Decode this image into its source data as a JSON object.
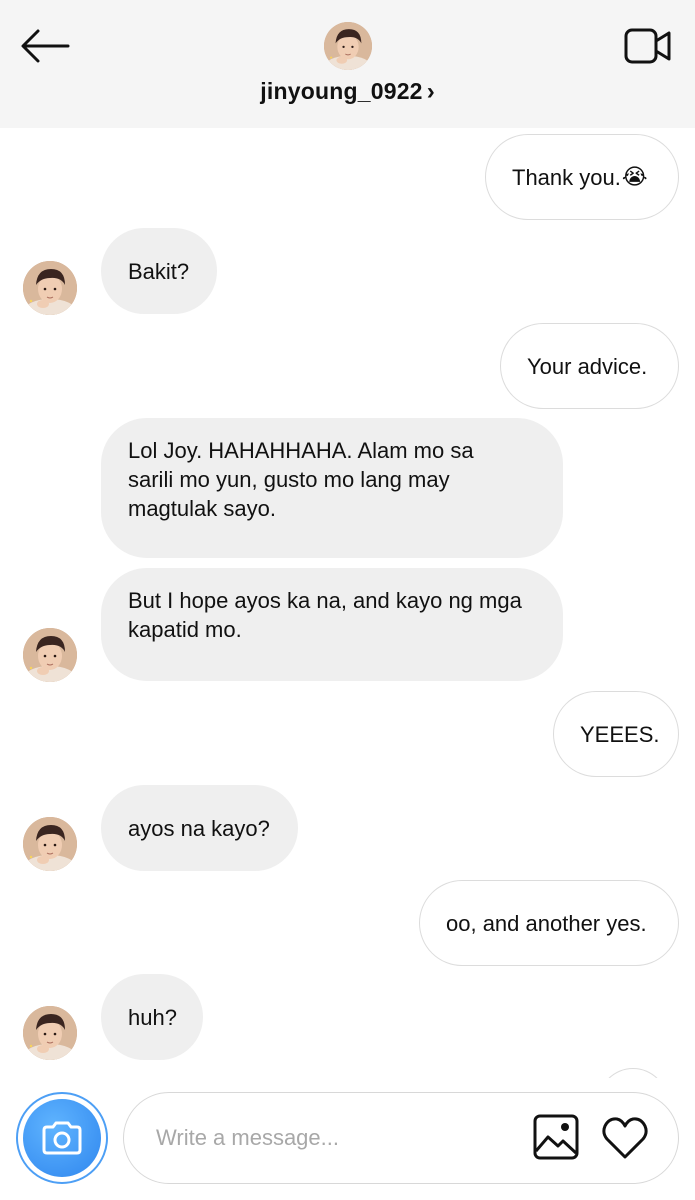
{
  "header": {
    "username": "jinyoung_0922",
    "chevron": "›",
    "icons": {
      "back": "arrow-left-icon",
      "video": "video-camera-icon"
    }
  },
  "messages": [
    {
      "from": "me",
      "text": "Thank you.",
      "emoji": "😭"
    },
    {
      "from": "them",
      "text": "Bakit?"
    },
    {
      "from": "me",
      "text": "Your advice."
    },
    {
      "from": "them",
      "lines": [
        "Lol Joy. HAHAHHAHA. Alam mo sa",
        "sarili mo yun, gusto mo lang may",
        "magtulak sayo."
      ]
    },
    {
      "from": "them",
      "lines": [
        "But I hope ayos ka na, and kayo ng mga",
        "kapatid mo."
      ]
    },
    {
      "from": "me",
      "text": "YEEES."
    },
    {
      "from": "them",
      "text": "ayos na kayo?"
    },
    {
      "from": "me",
      "text": "oo, and another yes."
    },
    {
      "from": "them",
      "text": "huh?"
    }
  ],
  "composer": {
    "placeholder": "Write a message...",
    "icons": {
      "camera": "camera-icon",
      "gallery": "image-icon",
      "like": "heart-icon"
    }
  },
  "colors": {
    "header_bg": "#f5f5f5",
    "incoming_bubble": "#efefef",
    "outgoing_border": "#dcdcdc",
    "camera_blue": "#3f95f2"
  }
}
